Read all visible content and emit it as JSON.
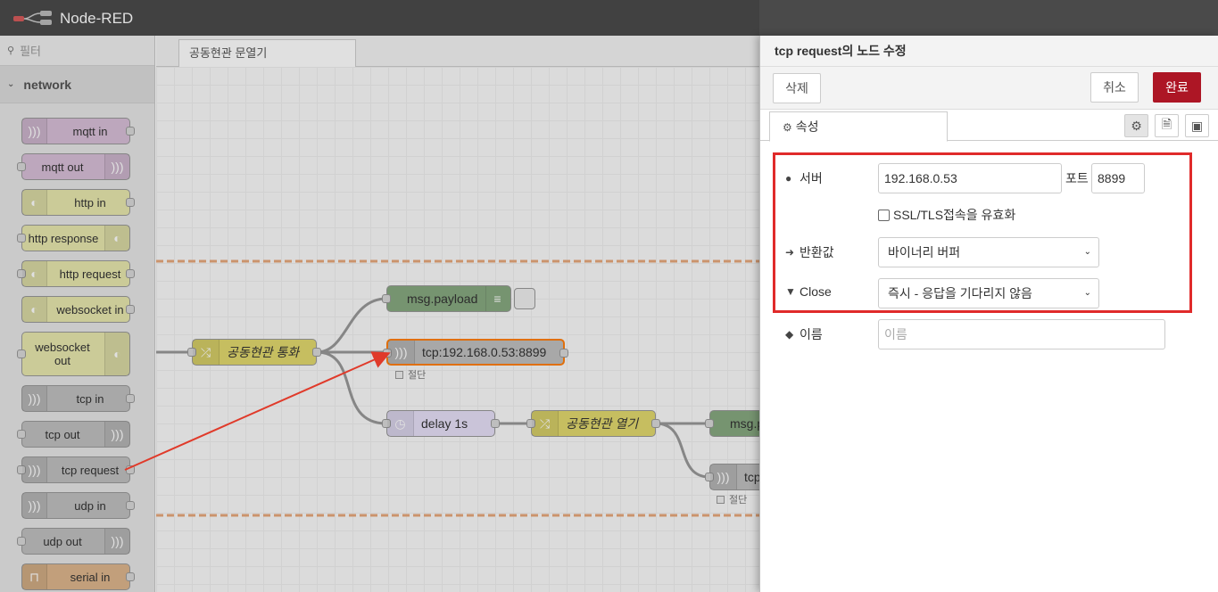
{
  "header": {
    "app_title": "Node-RED"
  },
  "palette": {
    "filter_placeholder": "필터",
    "category": "network",
    "nodes": [
      {
        "label": "mqtt in"
      },
      {
        "label": "mqtt out"
      },
      {
        "label": "http in"
      },
      {
        "label": "http response"
      },
      {
        "label": "http request"
      },
      {
        "label": "websocket in"
      },
      {
        "label": "websocket out"
      },
      {
        "label": "tcp in"
      },
      {
        "label": "tcp out"
      },
      {
        "label": "tcp request"
      },
      {
        "label": "udp in"
      },
      {
        "label": "udp out"
      },
      {
        "label": "serial in"
      }
    ]
  },
  "workspace": {
    "tab_label": "공동현관 문열기",
    "flow_nodes": [
      {
        "label": "공동현관 통화"
      },
      {
        "label": "msg.payload"
      },
      {
        "label": "tcp:192.168.0.53:8899"
      },
      {
        "label": "delay 1s"
      },
      {
        "label": "공동현관 열기"
      },
      {
        "label": "msg.p"
      },
      {
        "label": "tcp"
      }
    ],
    "status_text": "절단"
  },
  "editor": {
    "title": "tcp request의 노드 수정",
    "delete_label": "삭제",
    "cancel_label": "취소",
    "done_label": "완료",
    "properties_tab": "속성",
    "server_label": "서버",
    "server_value": "192.168.0.53",
    "port_label": "포트",
    "port_value": "8899",
    "ssl_label": "SSL/TLS접속을 유효화",
    "return_label": "반환값",
    "return_value": "바이너리 버퍼",
    "close_label": "Close",
    "close_value": "즉시 - 응답을 기다리지 않음",
    "name_label": "이름",
    "name_placeholder": "이름"
  },
  "colors": {
    "header_bg": "#4a4a4a",
    "done_button": "#ad1625",
    "highlight_box": "#e02a2a",
    "annotation_arrow": "#e03a2a"
  }
}
